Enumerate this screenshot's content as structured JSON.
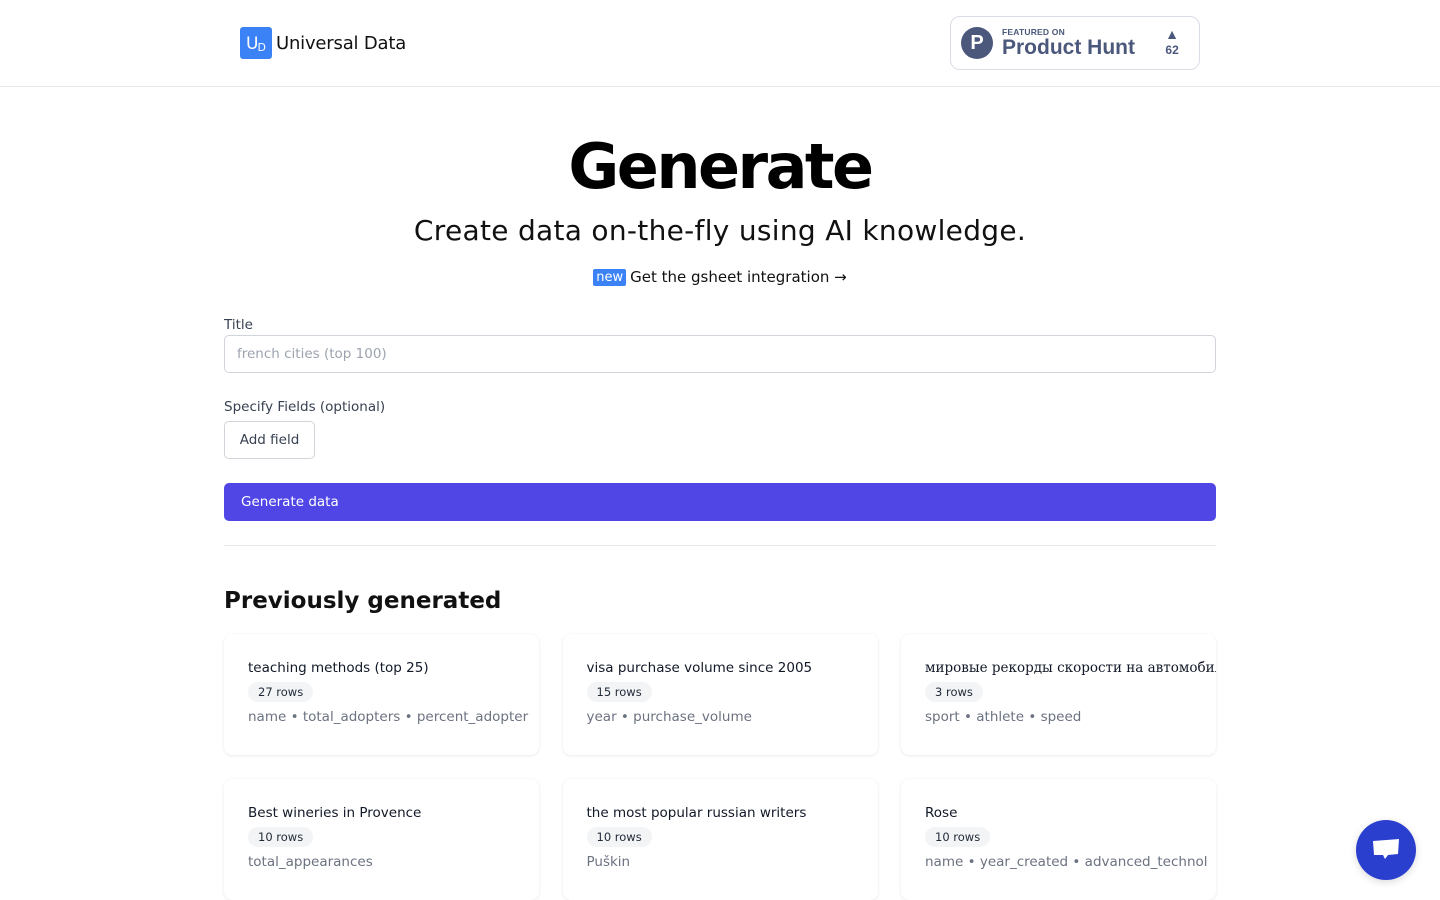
{
  "header": {
    "brand_logo_text": "U",
    "brand_logo_sub": "D",
    "brand_name": "Universal Data",
    "product_hunt": {
      "featured_label": "FEATURED ON",
      "name": "Product Hunt",
      "logo_letter": "P",
      "upvote_arrow": "▲",
      "upvote_count": "62"
    }
  },
  "hero": {
    "title": "Generate",
    "subtitle": "Create data on-the-fly using AI knowledge.",
    "promo_badge": "new",
    "promo_link": "Get the gsheet integration →"
  },
  "form": {
    "title_label": "Title",
    "title_value": "",
    "title_placeholder": "french cities (top 100)",
    "fields_label": "Specify Fields (optional)",
    "add_field_label": "Add field",
    "generate_label": "Generate data"
  },
  "colors": {
    "primary": "#4f46e5",
    "brand": "#3b82f6",
    "product_hunt": "#4b587c",
    "chat": "#2b3fcf"
  },
  "previous": {
    "title": "Previously generated",
    "items": [
      {
        "title": "teaching methods (top 25)",
        "rows": "27 rows",
        "fields": "name • total_adopters • percent_adopter"
      },
      {
        "title": "visa purchase volume since 2005",
        "rows": "15 rows",
        "fields": "year • purchase_volume"
      },
      {
        "title": "мировые рекорды скорости на автомобилях",
        "rows": "3 rows",
        "fields": "sport • athlete • speed"
      },
      {
        "title": "Best wineries in Provence",
        "rows": "10 rows",
        "fields": "total_appearances"
      },
      {
        "title": "the most popular russian writers",
        "rows": "10 rows",
        "fields": "Puškin"
      },
      {
        "title": "Rose",
        "rows": "10 rows",
        "fields": "name • year_created • advanced_technol"
      }
    ]
  },
  "chat": {
    "icon": "chat-bubble-icon"
  }
}
